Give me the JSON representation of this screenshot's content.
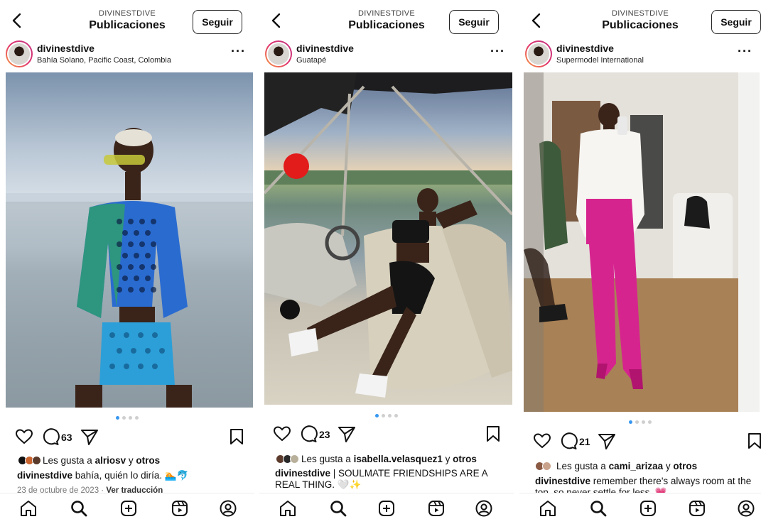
{
  "panels": [
    {
      "header": {
        "account": "DIVINESTDIVE",
        "title": "Publicaciones",
        "follow_label": "Seguir"
      },
      "user": {
        "name": "divinestdive",
        "location": "Bahía Solano, Pacific Coast, Colombia"
      },
      "more_label": "···",
      "carousel": {
        "count": 4,
        "active": 0
      },
      "comment_count": "63",
      "likes": {
        "prefix": "Les gusta a ",
        "user": "alriosv",
        "joiner": " y ",
        "others": "otros"
      },
      "caption": {
        "user": "divinestdive",
        "text": " bahía, quién lo diría. 🏊🐬"
      },
      "date": "23 de octubre de 2023",
      "separator": " · ",
      "translate": "Ver traducción"
    },
    {
      "header": {
        "account": "DIVINESTDIVE",
        "title": "Publicaciones",
        "follow_label": "Seguir"
      },
      "user": {
        "name": "divinestdive",
        "location": "Guatapé"
      },
      "more_label": "···",
      "carousel": {
        "count": 4,
        "active": 0
      },
      "comment_count": "23",
      "likes": {
        "prefix": "Les gusta a ",
        "user": "isabella.velasquez1",
        "joiner": " y ",
        "others": "otros"
      },
      "caption": {
        "user": "divinestdive",
        "text": " | SOULMATE FRIENDSHIPS ARE A REAL THING. 🤍✨"
      }
    },
    {
      "header": {
        "account": "DIVINESTDIVE",
        "title": "Publicaciones",
        "follow_label": "Seguir"
      },
      "user": {
        "name": "divinestdive",
        "location": "Supermodel International"
      },
      "more_label": "···",
      "carousel": {
        "count": 4,
        "active": 0
      },
      "comment_count": "21",
      "likes": {
        "prefix": "Les gusta a ",
        "user": "cami_arizaa",
        "joiner": " y ",
        "others": "otros"
      },
      "caption": {
        "user": "divinestdive",
        "text": " remember there's always room at the top, so never settle for less. 💗"
      }
    }
  ],
  "icons": {
    "back": "chevron-left-icon",
    "like": "heart-icon",
    "comment": "comment-bubble-icon",
    "share": "paper-plane-icon",
    "save": "bookmark-icon",
    "nav": [
      "home-icon",
      "search-icon",
      "new-post-icon",
      "reels-icon",
      "profile-icon"
    ]
  },
  "colors": {
    "accent": "#3797f0",
    "text": "#111111",
    "muted": "#777777",
    "story_ring": "#e1306c",
    "outfit_pink": "#d6248f"
  }
}
